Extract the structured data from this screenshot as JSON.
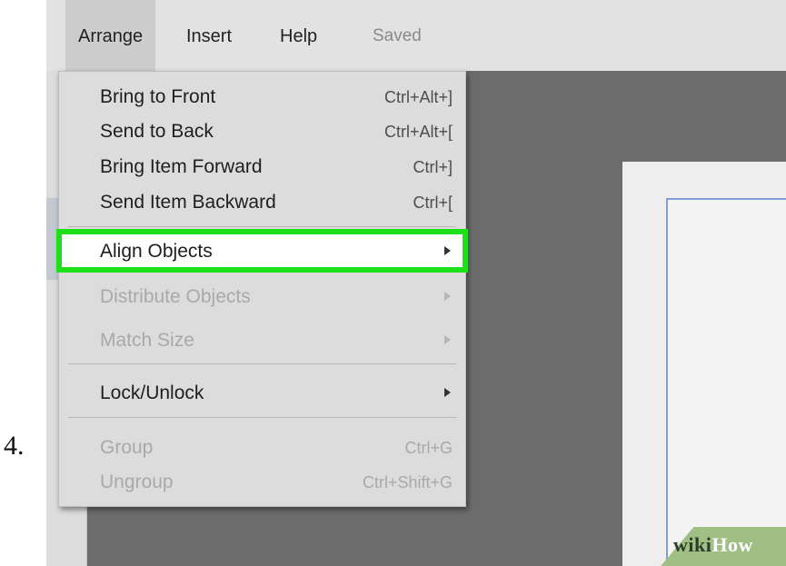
{
  "step_number": "4.",
  "menubar": {
    "items": [
      {
        "label": "Arrange"
      },
      {
        "label": "Insert"
      },
      {
        "label": "Help"
      }
    ],
    "status": "Saved"
  },
  "arrange_menu": {
    "items": [
      {
        "label": "Bring to Front",
        "shortcut": "Ctrl+Alt+]"
      },
      {
        "label": "Send to Back",
        "shortcut": "Ctrl+Alt+["
      },
      {
        "label": "Bring Item Forward",
        "shortcut": "Ctrl+]"
      },
      {
        "label": "Send Item Backward",
        "shortcut": "Ctrl+["
      },
      {
        "label": "Align Objects",
        "highlighted": true,
        "submenu": true
      },
      {
        "label": "Distribute Objects",
        "disabled": true,
        "submenu": true
      },
      {
        "label": "Match Size",
        "disabled": true,
        "submenu": true
      },
      {
        "label": "Lock/Unlock",
        "submenu": true
      },
      {
        "label": "Group",
        "shortcut": "Ctrl+G",
        "disabled": true
      },
      {
        "label": "Ungroup",
        "shortcut": "Ctrl+Shift+G",
        "disabled": true
      }
    ]
  },
  "watermark": {
    "wiki": "wiki",
    "how": "How"
  },
  "colors": {
    "highlight_outline": "#1ee01a",
    "canvas_bg": "#696969",
    "menu_bg": "#dcdcdc"
  }
}
